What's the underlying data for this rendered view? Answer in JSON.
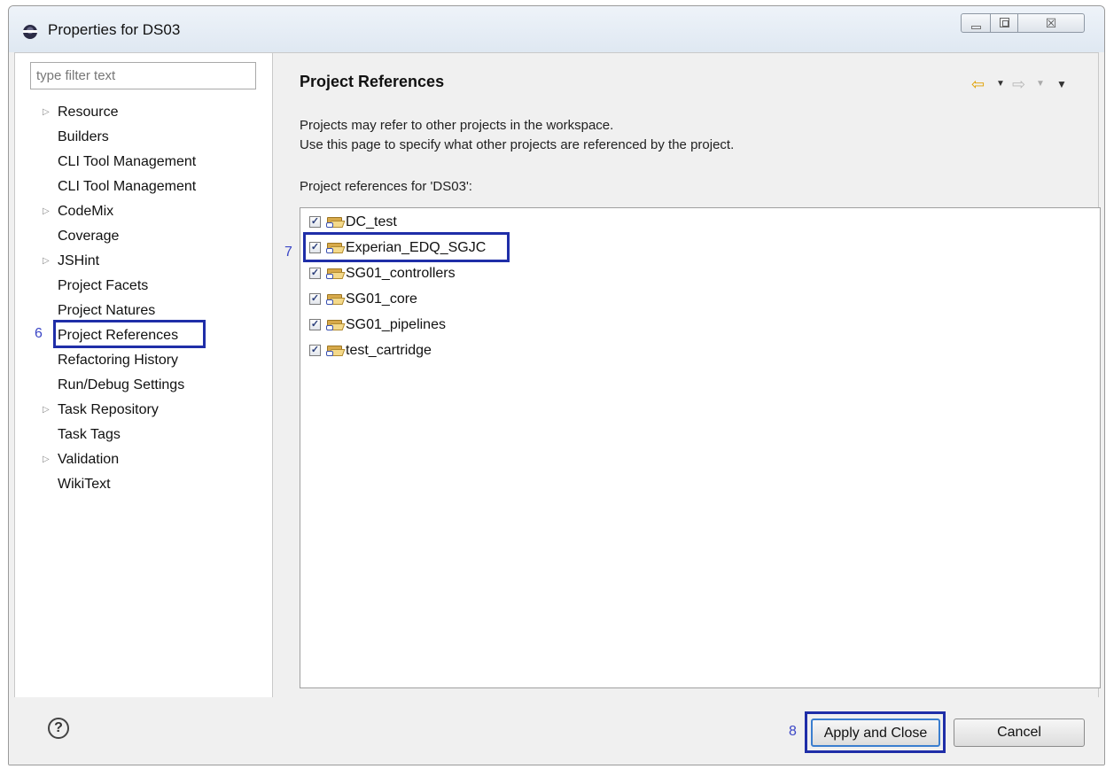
{
  "window": {
    "title": "Properties for DS03",
    "controls": {
      "minimize_icon": "minimize-icon",
      "maximize_icon": "maximize-icon",
      "close_label": "☒"
    }
  },
  "sidebar": {
    "filter_placeholder": "type filter text",
    "items": [
      {
        "label": "Resource",
        "expandable": true
      },
      {
        "label": "Builders",
        "expandable": false
      },
      {
        "label": "CLI Tool Management",
        "expandable": false
      },
      {
        "label": "CLI Tool Management",
        "expandable": false
      },
      {
        "label": "CodeMix",
        "expandable": true
      },
      {
        "label": "Coverage",
        "expandable": false
      },
      {
        "label": "JSHint",
        "expandable": true
      },
      {
        "label": "Project Facets",
        "expandable": false
      },
      {
        "label": "Project Natures",
        "expandable": false
      },
      {
        "label": "Project References",
        "expandable": false,
        "selected": true
      },
      {
        "label": "Refactoring History",
        "expandable": false
      },
      {
        "label": "Run/Debug Settings",
        "expandable": false
      },
      {
        "label": "Task Repository",
        "expandable": true
      },
      {
        "label": "Task Tags",
        "expandable": false
      },
      {
        "label": "Validation",
        "expandable": true
      },
      {
        "label": "WikiText",
        "expandable": false
      }
    ],
    "step_marker": "6"
  },
  "main": {
    "title": "Project References",
    "description_line1": "Projects may refer to other projects in the workspace.",
    "description_line2": "Use this page to specify what other projects are referenced by the project.",
    "references_label": "Project references for 'DS03':",
    "projects": [
      {
        "name": "DC_test",
        "checked": true
      },
      {
        "name": "Experian_EDQ_SGJC",
        "checked": true
      },
      {
        "name": "SG01_controllers",
        "checked": true
      },
      {
        "name": "SG01_core",
        "checked": true
      },
      {
        "name": "SG01_pipelines",
        "checked": true
      },
      {
        "name": "test_cartridge",
        "checked": true
      }
    ],
    "step_marker": "7",
    "nav_icons": [
      "back-arrow-icon",
      "dropdown-icon",
      "forward-arrow-icon",
      "dropdown-icon",
      "view-menu-icon"
    ]
  },
  "footer": {
    "help_icon": "help-icon",
    "help_glyph": "?",
    "apply_label": "Apply and Close",
    "cancel_label": "Cancel",
    "step_marker": "8"
  },
  "colors": {
    "annotation_box": "#1f2ea8",
    "annotation_number": "#3b46c6",
    "back_arrow": "#e0a000"
  }
}
